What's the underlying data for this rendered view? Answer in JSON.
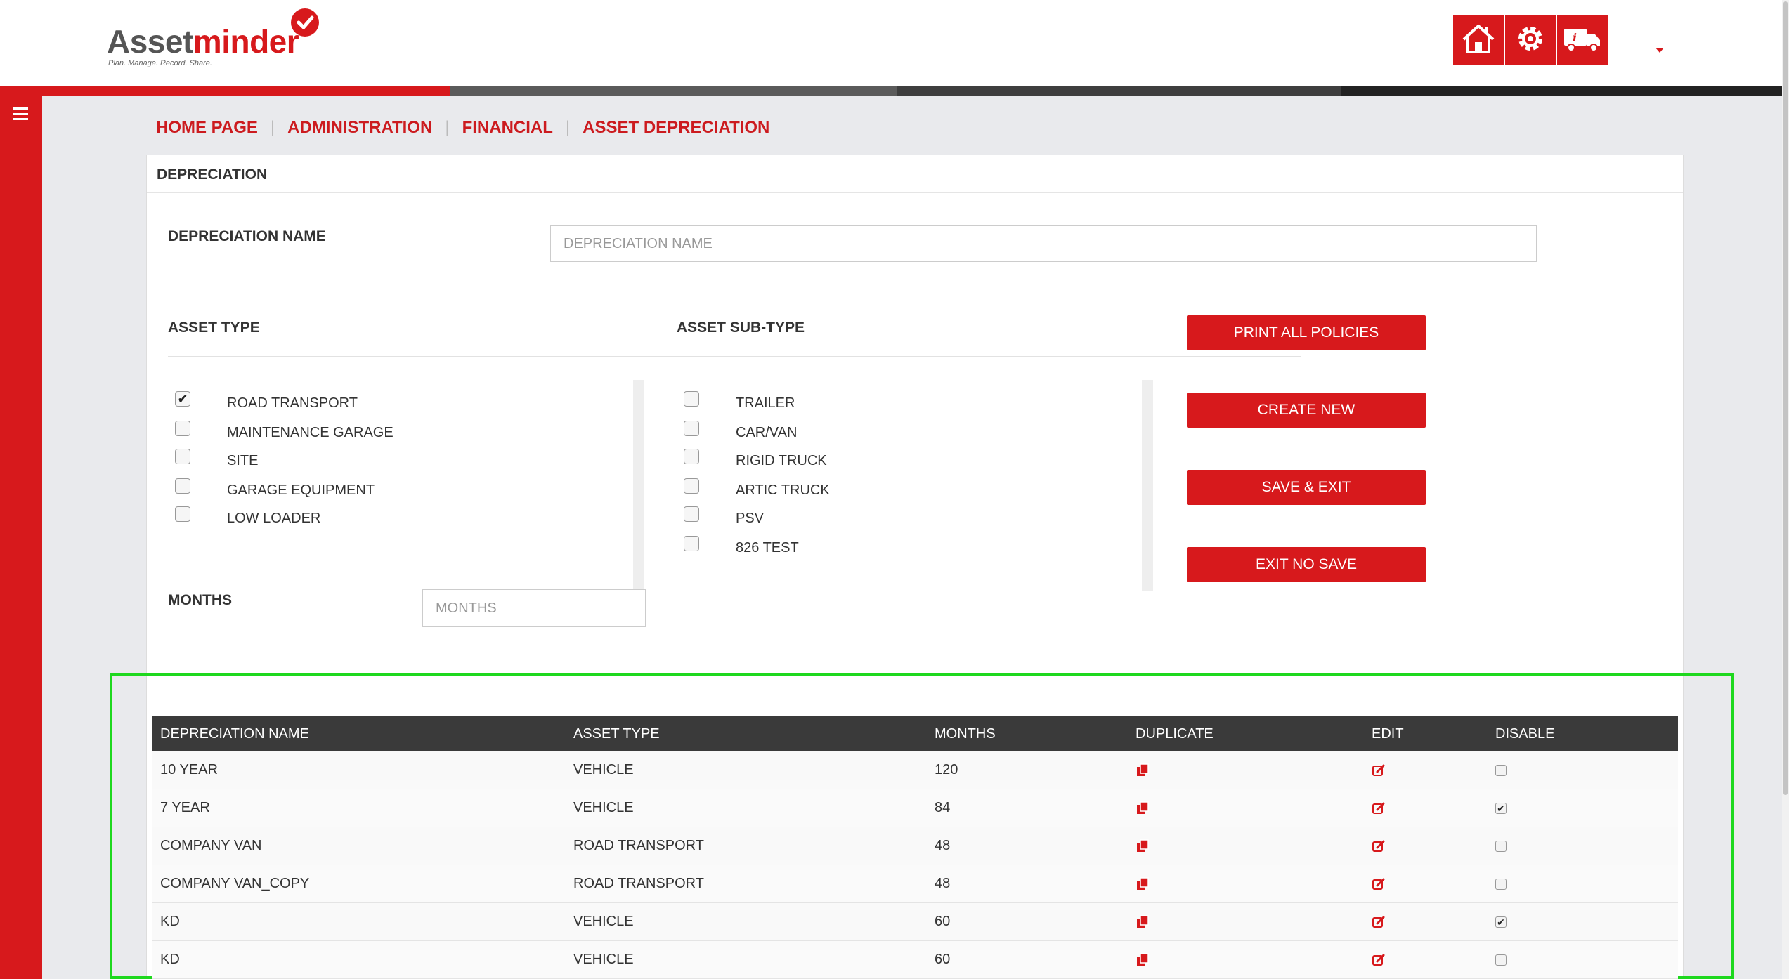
{
  "app": {
    "logo_part1": "Asset",
    "logo_part2": "minder",
    "tagline": "Plan. Manage. Record. Share.",
    "brand_color": "#d7191c",
    "header_buttons": [
      {
        "icon": "home-icon"
      },
      {
        "icon": "settings-gear-icon"
      },
      {
        "icon": "truck-info-icon"
      }
    ]
  },
  "breadcrumb": [
    "HOME PAGE",
    "ADMINISTRATION",
    "FINANCIAL",
    "ASSET DEPRECIATION"
  ],
  "panel": {
    "title": "DEPRECIATION",
    "name_label": "DEPRECIATION NAME",
    "name_placeholder": "DEPRECIATION NAME",
    "asset_type_label": "ASSET TYPE",
    "asset_subtype_label": "ASSET SUB-TYPE",
    "months_label": "MONTHS",
    "months_placeholder": "MONTHS",
    "asset_types": [
      {
        "label": "ROAD TRANSPORT",
        "checked": true
      },
      {
        "label": "MAINTENANCE GARAGE",
        "checked": false
      },
      {
        "label": "SITE",
        "checked": false
      },
      {
        "label": "GARAGE EQUIPMENT",
        "checked": false
      },
      {
        "label": "LOW LOADER",
        "checked": false
      }
    ],
    "asset_subtypes": [
      {
        "label": "TRAILER",
        "checked": false
      },
      {
        "label": "CAR/VAN",
        "checked": false
      },
      {
        "label": "RIGID TRUCK",
        "checked": false
      },
      {
        "label": "ARTIC TRUCK",
        "checked": false
      },
      {
        "label": "PSV",
        "checked": false
      },
      {
        "label": "826 TEST",
        "checked": false
      }
    ],
    "buttons": {
      "print_all": "PRINT ALL POLICIES",
      "create_new": "CREATE NEW",
      "save_exit": "SAVE & EXIT",
      "exit_no_save": "EXIT NO SAVE"
    }
  },
  "table": {
    "headers": [
      "DEPRECIATION NAME",
      "ASSET TYPE",
      "MONTHS",
      "DUPLICATE",
      "EDIT",
      "DISABLE"
    ],
    "rows": [
      {
        "name": "10 YEAR",
        "asset_type": "VEHICLE",
        "months": "120",
        "disabled": false
      },
      {
        "name": "7 YEAR",
        "asset_type": "VEHICLE",
        "months": "84",
        "disabled": true
      },
      {
        "name": "COMPANY VAN",
        "asset_type": "ROAD TRANSPORT",
        "months": "48",
        "disabled": false
      },
      {
        "name": "COMPANY VAN_COPY",
        "asset_type": "ROAD TRANSPORT",
        "months": "48",
        "disabled": false
      },
      {
        "name": "KD",
        "asset_type": "VEHICLE",
        "months": "60",
        "disabled": true
      },
      {
        "name": "KD",
        "asset_type": "VEHICLE",
        "months": "60",
        "disabled": false
      }
    ]
  }
}
